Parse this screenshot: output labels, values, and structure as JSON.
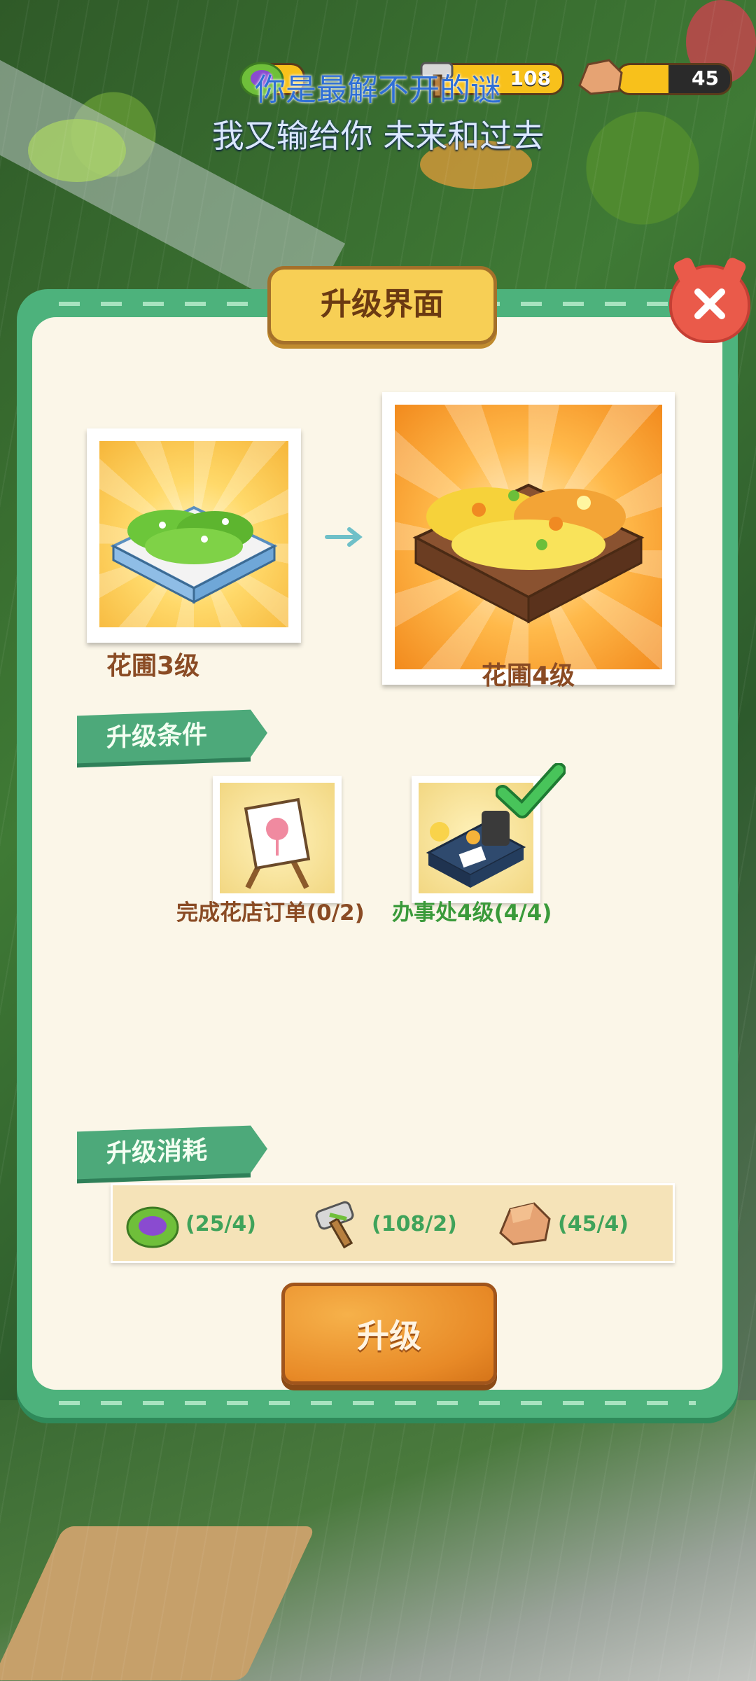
{
  "hud": {
    "resources": [
      {
        "icon": "cabbage-icon",
        "value": ""
      },
      {
        "icon": "hammer-icon",
        "value": "108"
      },
      {
        "icon": "stone-icon",
        "value": "45"
      }
    ]
  },
  "lyrics": {
    "line1": "你是最解不开的谜",
    "line2": "我又输给你 未来和过去"
  },
  "panel": {
    "title": "升级界面",
    "current": {
      "label": "花圃3级"
    },
    "next": {
      "label": "花圃4级"
    },
    "conditions_title": "升级条件",
    "conditions": [
      {
        "label": "完成花店订单(0/2)",
        "color": "#8a4b24",
        "icon": "flower-easel-icon",
        "done": false
      },
      {
        "label": "办事处4级(4/4)",
        "color": "#3a9a3a",
        "icon": "office-desk-icon",
        "done": true
      }
    ],
    "cost_title": "升级消耗",
    "costs": [
      {
        "icon": "cabbage-icon",
        "text": "(25/4)"
      },
      {
        "icon": "hammer-icon",
        "text": "(108/2)"
      },
      {
        "icon": "stone-icon",
        "text": "(45/4)"
      }
    ],
    "upgrade_button": "升级"
  },
  "colors": {
    "panel_border": "#4db27c",
    "panel_bg": "#fbf6e8",
    "ribbon": "#4da97a",
    "button": "#e88a27",
    "close": "#ea5a4a"
  }
}
